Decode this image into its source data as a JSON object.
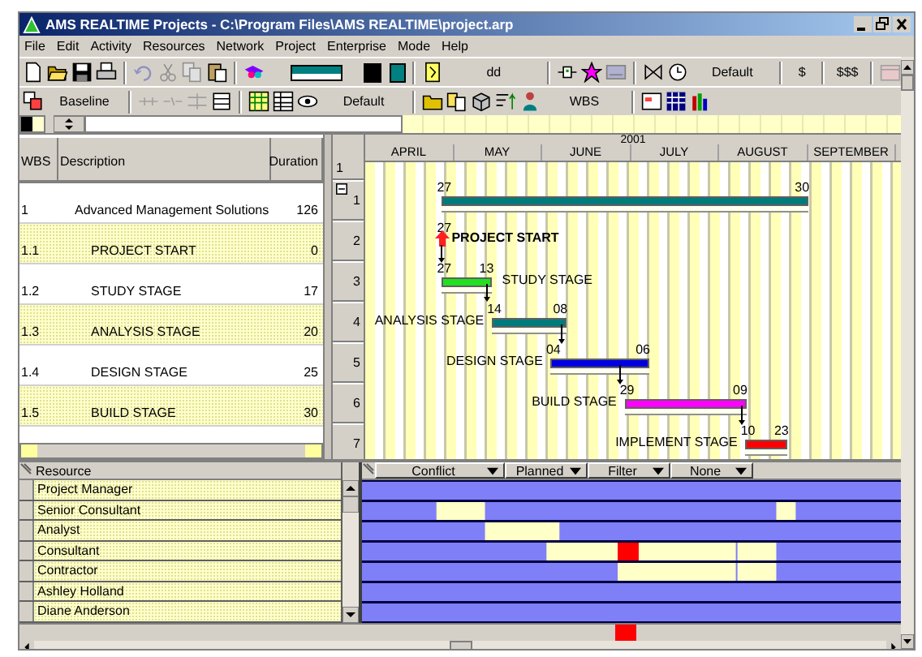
{
  "window": {
    "title": "AMS REALTIME Projects - C:\\Program Files\\AMS REALTIME\\project.arp"
  },
  "menu": [
    "File",
    "Edit",
    "Activity",
    "Resources",
    "Network",
    "Project",
    "Enterprise",
    "Mode",
    "Help"
  ],
  "toolbar_1": {
    "date_format": "dd",
    "view": "Default",
    "cost": "$",
    "cost_detail": "$$$"
  },
  "toolbar_2": {
    "baseline": "Baseline",
    "layout": "Default",
    "code": "WBS"
  },
  "table": {
    "columns": [
      "WBS",
      "Description",
      "Duration"
    ],
    "rows": [
      {
        "wbs": "1",
        "description": "Advanced Management Solutions",
        "duration": "126",
        "expanded": true,
        "children": [
          {
            "wbs": "1.1",
            "description": "PROJECT START",
            "duration": "0"
          },
          {
            "wbs": "1.2",
            "description": "STUDY STAGE",
            "duration": "17"
          },
          {
            "wbs": "1.3",
            "description": "ANALYSIS STAGE",
            "duration": "20"
          },
          {
            "wbs": "1.4",
            "description": "DESIGN STAGE",
            "duration": "25"
          },
          {
            "wbs": "1.5",
            "description": "BUILD STAGE",
            "duration": "30"
          }
        ]
      }
    ]
  },
  "row_numbers": {
    "header": "1",
    "rows": [
      "1",
      "2",
      "3",
      "4",
      "5",
      "6",
      "7"
    ]
  },
  "gantt": {
    "year": "2001",
    "months": [
      "APRIL",
      "MAY",
      "JUNE",
      "JULY",
      "AUGUST",
      "SEPTEMBER"
    ],
    "bars": [
      {
        "kind": "bar",
        "start": "27",
        "end": "30",
        "color": "#007b7b"
      },
      {
        "kind": "milestone",
        "start": "27",
        "label": "PROJECT START",
        "color": "#ff2020"
      },
      {
        "kind": "bar",
        "start": "27",
        "end": "13",
        "label": "STUDY STAGE",
        "color": "#20e020"
      },
      {
        "kind": "bar",
        "start": "14",
        "end": "08",
        "label": "ANALYSIS STAGE",
        "color": "#007b7b"
      },
      {
        "kind": "bar",
        "start": "04",
        "end": "06",
        "label": "DESIGN STAGE",
        "color": "#0000e0"
      },
      {
        "kind": "bar",
        "start": "29",
        "end": "09",
        "label": "BUILD STAGE",
        "color": "#ff00ff"
      },
      {
        "kind": "bar",
        "start": "10",
        "end": "23",
        "label": "IMPLEMENT STAGE",
        "color": "#ff0000"
      }
    ]
  },
  "resources": {
    "header": "Resource",
    "filters": [
      "Conflict",
      "Planned",
      "Filter",
      "None"
    ],
    "rows": [
      "Project Manager",
      "Senior Consultant",
      "Analyst",
      "Consultant",
      "Contractor",
      "Ashley Holland",
      "Diane Anderson"
    ]
  }
}
